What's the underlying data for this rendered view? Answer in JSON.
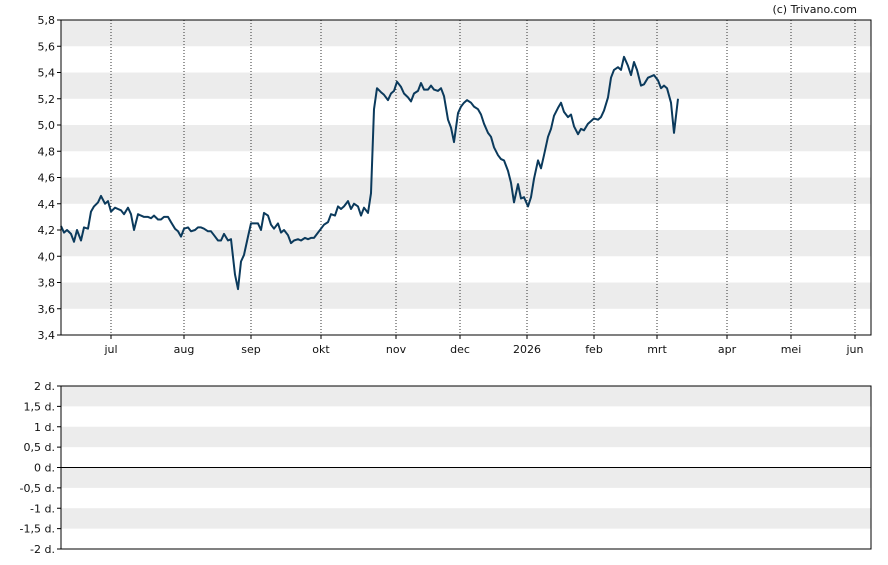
{
  "credit": "(c) Trivano.com",
  "colors": {
    "line": "#0b3a5c",
    "band": "#ececec",
    "frame": "#000000",
    "grid": "#333333"
  },
  "chart_data": [
    {
      "type": "line",
      "ylim": [
        3.4,
        5.8
      ],
      "y_ticks": [
        "3,4",
        "3,6",
        "3,8",
        "4,0",
        "4,2",
        "4,4",
        "4,6",
        "4,8",
        "5,0",
        "5,2",
        "5,4",
        "5,6",
        "5,8"
      ],
      "x_ticks": [
        "jul",
        "aug",
        "sep",
        "okt",
        "nov",
        "dec",
        "2026",
        "feb",
        "mrt",
        "apr",
        "mei",
        "jun"
      ],
      "x": [
        0,
        3,
        6,
        10,
        13,
        16,
        20,
        23,
        27,
        30,
        33,
        37,
        40,
        44,
        47,
        50,
        54,
        57,
        60,
        63,
        67,
        70,
        73,
        77,
        80,
        83,
        87,
        90,
        93,
        97,
        100,
        103,
        107,
        110,
        114,
        117,
        120,
        123,
        127,
        130,
        134,
        137,
        140,
        143,
        147,
        150,
        153,
        157,
        160,
        163,
        167,
        170,
        174,
        177,
        180,
        183,
        187,
        190,
        193,
        197,
        200,
        203,
        207,
        210,
        213,
        217,
        220,
        223,
        227,
        230,
        233,
        237,
        240,
        244,
        247,
        250,
        253,
        257,
        260,
        263,
        267,
        270,
        274,
        277,
        280,
        283,
        287,
        290,
        293,
        297,
        300,
        303,
        307,
        310,
        313,
        316,
        320,
        323,
        327,
        330,
        333,
        336,
        340,
        343,
        347,
        350,
        353,
        357,
        360,
        363,
        367,
        370,
        373,
        377,
        380,
        383,
        387,
        390,
        393,
        397,
        400,
        403,
        406,
        410,
        413,
        417,
        420,
        423,
        427,
        430,
        433,
        437,
        440,
        443,
        447,
        450,
        453,
        457,
        460,
        463,
        467,
        470,
        473,
        477,
        480,
        483,
        487,
        490,
        493,
        497,
        500,
        503,
        507,
        510,
        513,
        517,
        520,
        523,
        527,
        530,
        533,
        537,
        540,
        543,
        547,
        550,
        553,
        557,
        560,
        563,
        567,
        570,
        573,
        576,
        580,
        583,
        587,
        590,
        593,
        597,
        600,
        603,
        606,
        610,
        613,
        617,
        620,
        623,
        627,
        630,
        633,
        637,
        640,
        643,
        647,
        650,
        653,
        657,
        660,
        663,
        666,
        670,
        673,
        677,
        680,
        683,
        687,
        690,
        693,
        696,
        700,
        703,
        707,
        710,
        713,
        717,
        720,
        723,
        727,
        730,
        733,
        737,
        740,
        743,
        747,
        750,
        753,
        757,
        760,
        763,
        767,
        770,
        773,
        777,
        780,
        783,
        787,
        790,
        793,
        797,
        800,
        803,
        807,
        810
      ],
      "values": [
        4.23,
        4.18,
        4.2,
        4.17,
        4.11,
        4.2,
        4.12,
        4.22,
        4.21,
        4.34,
        4.38,
        4.41,
        4.46,
        4.4,
        4.42,
        4.34,
        4.37,
        4.36,
        4.35,
        4.32,
        4.37,
        4.32,
        4.2,
        4.32,
        4.31,
        4.3,
        4.3,
        4.29,
        4.31,
        4.28,
        4.28,
        4.3,
        4.3,
        4.26,
        4.21,
        4.19,
        4.15,
        4.21,
        4.22,
        4.19,
        4.2,
        4.22,
        4.22,
        4.21,
        4.19,
        4.19,
        4.16,
        4.12,
        4.12,
        4.17,
        4.12,
        4.13,
        3.86,
        3.75,
        3.96,
        4.01,
        4.15,
        4.25,
        4.25,
        4.25,
        4.2,
        4.33,
        4.31,
        4.24,
        4.21,
        4.25,
        4.18,
        4.2,
        4.16,
        4.1,
        4.12,
        4.13,
        4.12,
        4.14,
        4.13,
        4.14,
        4.14,
        4.18,
        4.21,
        4.24,
        4.26,
        4.32,
        4.31,
        4.38,
        4.36,
        4.38,
        4.42,
        4.36,
        4.4,
        4.38,
        4.31,
        4.37,
        4.33,
        4.48,
        5.12,
        5.28,
        5.25,
        5.23,
        5.19,
        5.24,
        5.26,
        5.33,
        5.29,
        5.24,
        5.21,
        5.18,
        5.24,
        5.26,
        5.32,
        5.27,
        5.27,
        5.3,
        5.27,
        5.26,
        5.28,
        5.22,
        5.04,
        4.98,
        4.87,
        5.09,
        5.14,
        5.17,
        5.19,
        5.17,
        5.14,
        5.12,
        5.08,
        5.01,
        4.94,
        4.91,
        4.83,
        4.77,
        4.74,
        4.73,
        4.65,
        4.56,
        4.41,
        4.55,
        4.44,
        4.45,
        4.38,
        4.45,
        4.59,
        4.73,
        4.67,
        4.77,
        4.91,
        4.97,
        5.07,
        5.13,
        5.17,
        5.1,
        5.06,
        5.08,
        4.99,
        4.93,
        4.97,
        4.96,
        5.01,
        5.03,
        5.05,
        5.04,
        5.06,
        5.11,
        5.21,
        5.36,
        5.42,
        5.44,
        5.42,
        5.52,
        5.45,
        5.38,
        5.48,
        5.42,
        5.3,
        5.31,
        5.36,
        5.37,
        5.38,
        5.34,
        5.28,
        5.3,
        5.28,
        5.17,
        4.94,
        5.2
      ]
    },
    {
      "type": "line",
      "ylim": [
        -2,
        2
      ],
      "y_ticks": [
        "-2 d.",
        "-1,5 d.",
        "-1 d.",
        "-0,5 d.",
        "0 d.",
        "0,5 d.",
        "1 d.",
        "1,5 d.",
        "2 d."
      ],
      "values": []
    }
  ]
}
